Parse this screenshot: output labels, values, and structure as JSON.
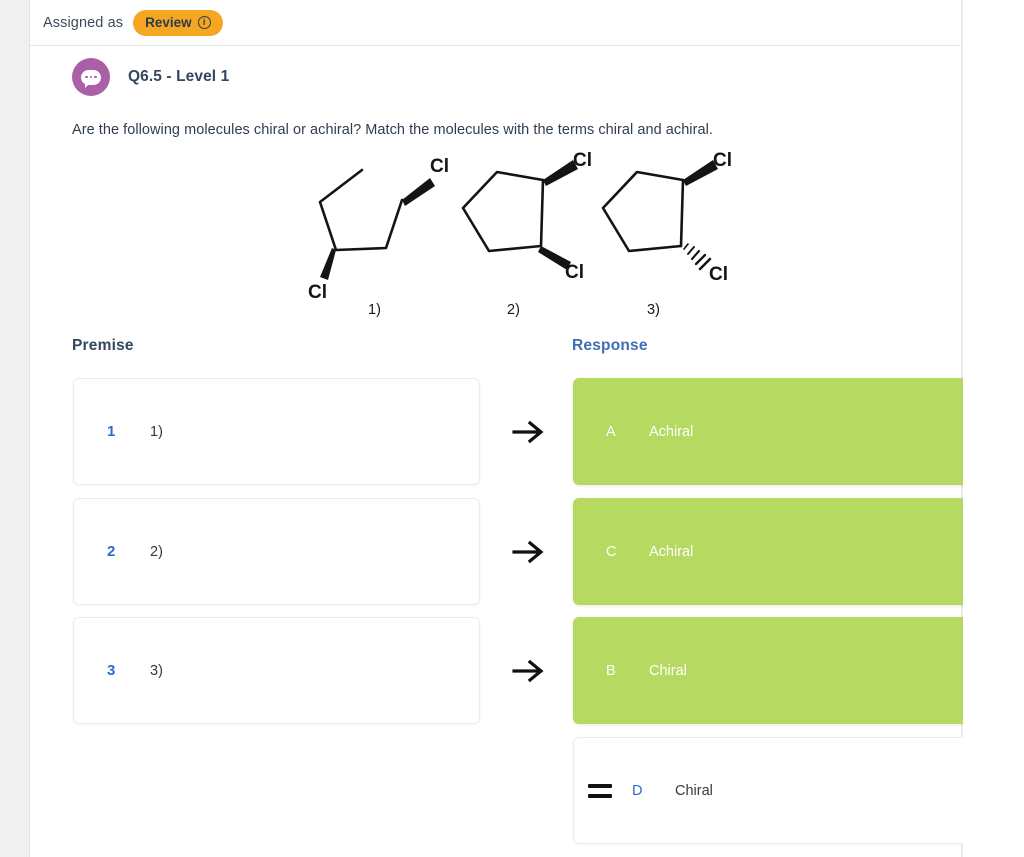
{
  "header": {
    "assigned_label": "Assigned as",
    "badge_label": "Review",
    "badge_icon": "info-circle-icon",
    "badge_color": "#f5a623"
  },
  "question": {
    "avatar_icon": "speech-bubble-icon",
    "avatar_color": "#ab5fa6",
    "title": "Q6.5 - Level 1",
    "prompt": "Are the following molecules chiral or achiral? Match the molecules with the terms chiral and achiral."
  },
  "molecules": [
    {
      "caption": "1)",
      "cl_top_label": "Cl",
      "cl_bottom_label": "Cl"
    },
    {
      "caption": "2)",
      "cl_top_label": "Cl",
      "cl_bottom_label": "Cl"
    },
    {
      "caption": "3)",
      "cl_top_label": "Cl",
      "cl_bottom_label": "Cl"
    }
  ],
  "columns": {
    "premise_header": "Premise",
    "response_header": "Response",
    "premise_header_color": "#33475e",
    "response_header_color": "#3d6fb4"
  },
  "rows": [
    {
      "index": "1",
      "premise": "1)",
      "arrow_icon": "arrow-right-icon"
    },
    {
      "index": "2",
      "premise": "2)",
      "arrow_icon": "arrow-right-icon"
    },
    {
      "index": "3",
      "premise": "3)",
      "arrow_icon": "arrow-right-icon"
    }
  ],
  "responses": [
    {
      "letter": "A",
      "label": "Achiral",
      "state": "filled",
      "color": "#b6d962"
    },
    {
      "letter": "C",
      "label": "Achiral",
      "state": "filled",
      "color": "#b6d962"
    },
    {
      "letter": "B",
      "label": "Chiral",
      "state": "filled",
      "color": "#b6d962"
    },
    {
      "letter": "D",
      "label": "Chiral",
      "state": "empty",
      "color": "#ffffff",
      "handle_icon": "drag-handle-icon"
    }
  ]
}
